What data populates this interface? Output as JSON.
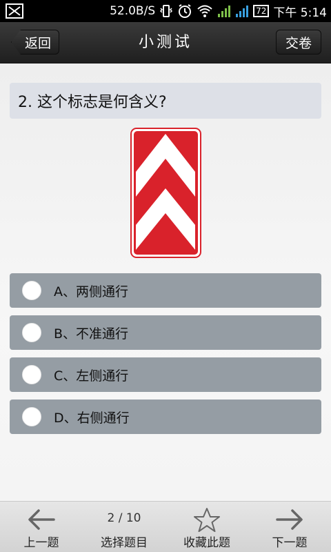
{
  "status_bar": {
    "speed": "52.0B/S",
    "battery": "72",
    "time": "下午 5:14"
  },
  "header": {
    "back_label": "返回",
    "title": "小测试",
    "submit_label": "交卷"
  },
  "question": {
    "text": "2. 这个标志是何含义?"
  },
  "options": [
    {
      "label": "A、两侧通行"
    },
    {
      "label": "B、不准通行"
    },
    {
      "label": "C、左侧通行"
    },
    {
      "label": "D、右侧通行"
    }
  ],
  "bottom_nav": {
    "prev_label": "上一题",
    "select_label": "选择题目",
    "counter": "2 / 10",
    "favorite_label": "收藏此题",
    "next_label": "下一题"
  },
  "colors": {
    "option_bg": "#959da4",
    "question_bg": "#dde0e7",
    "sign_red": "#d9222b"
  }
}
